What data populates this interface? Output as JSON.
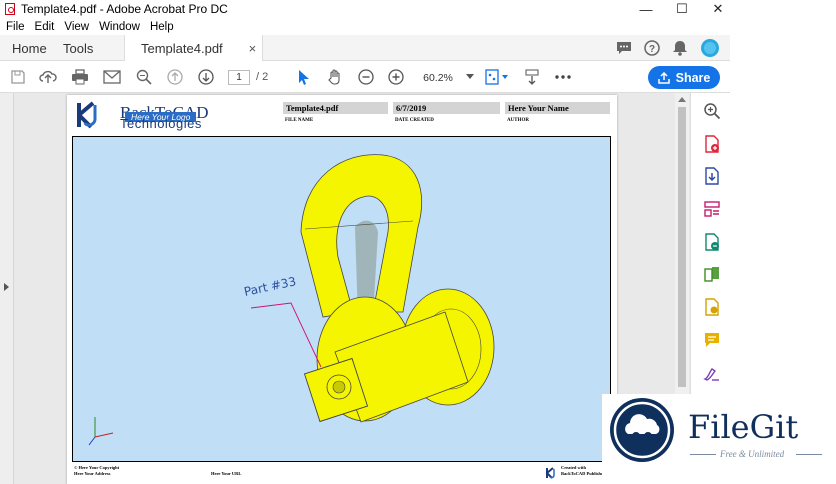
{
  "window": {
    "title": "Template4.pdf - Adobe Acrobat Pro DC",
    "controls": [
      "minimize-icon",
      "maximize-icon",
      "close-icon"
    ]
  },
  "menu": [
    "File",
    "Edit",
    "View",
    "Window",
    "Help"
  ],
  "tabs": {
    "home": "Home",
    "tools": "Tools",
    "document": "Template4.pdf",
    "close": "×"
  },
  "toolbar": {
    "page_current": "1",
    "page_total": "/ 2",
    "zoom": "60.2%",
    "share_label": "Share"
  },
  "document": {
    "logo_line1": "BackToCAD",
    "logo_tagline": "Here Your Logo",
    "logo_line2": "Technologies",
    "header_values": [
      "Template4.pdf",
      "6/7/2019",
      "Here Your Name"
    ],
    "header_labels": [
      "FILE NAME",
      "DATE CREATED",
      "AUTHOR"
    ],
    "part_label": "Part #33",
    "footer_left_1": "© Here Your Copyright",
    "footer_left_2": "Here Your Address",
    "footer_mid": "Here Your URL",
    "footer_right_1": "Created with",
    "footer_right_2": "BackToCAD Publisher"
  },
  "watermark": {
    "name": "FileGit",
    "tagline": "Free & Unlimited"
  },
  "colors": {
    "accent": "#1473e6",
    "drawing_bg": "#c1def7",
    "part_yellow": "#f5f500",
    "annotation": "#d0106e",
    "badge_navy": "#0f2f5c"
  }
}
